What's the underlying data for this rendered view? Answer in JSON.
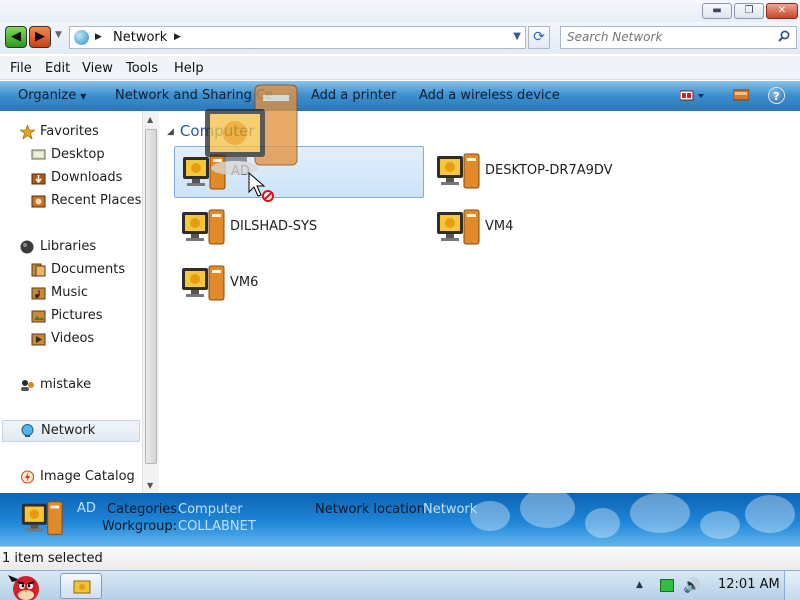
{
  "window": {
    "controls": {
      "minimize": "▬",
      "maximize": "❐",
      "close": "✕"
    }
  },
  "address_bar": {
    "location": "Network",
    "search_placeholder": "Search Network"
  },
  "menu": [
    "File",
    "Edit",
    "View",
    "Tools",
    "Help"
  ],
  "command_bar": {
    "organize": "Organize",
    "network_sharing": "Network and Sharing Ce",
    "add_printer": "Add a printer",
    "add_wireless": "Add a wireless device",
    "help": "?"
  },
  "nav": {
    "favorites": "Favorites",
    "desktop": "Desktop",
    "downloads": "Downloads",
    "recent": "Recent Places",
    "libraries": "Libraries",
    "documents": "Documents",
    "music": "Music",
    "pictures": "Pictures",
    "videos": "Videos",
    "mistake": "mistake",
    "network": "Network",
    "image_catalog": "Image Catalog"
  },
  "content": {
    "group_header": "Computer",
    "computers": [
      "AD",
      "DESKTOP-DR7A9DV",
      "DILSHAD-SYS",
      "VM4",
      "VM6"
    ],
    "selected": "AD"
  },
  "details": {
    "name": "AD",
    "categories_label": "Categories:",
    "categories_value": "Computer",
    "workgroup_label": "Workgroup:",
    "workgroup_value": "COLLABNET",
    "netloc_label": "Network location:",
    "netloc_value": "Network"
  },
  "status": "1 item selected",
  "taskbar": {
    "time": "12:01 AM"
  },
  "colors": {
    "accent": "#1d5aa6",
    "command_bar": "#3f91d0",
    "selection": "#cde3f8"
  }
}
